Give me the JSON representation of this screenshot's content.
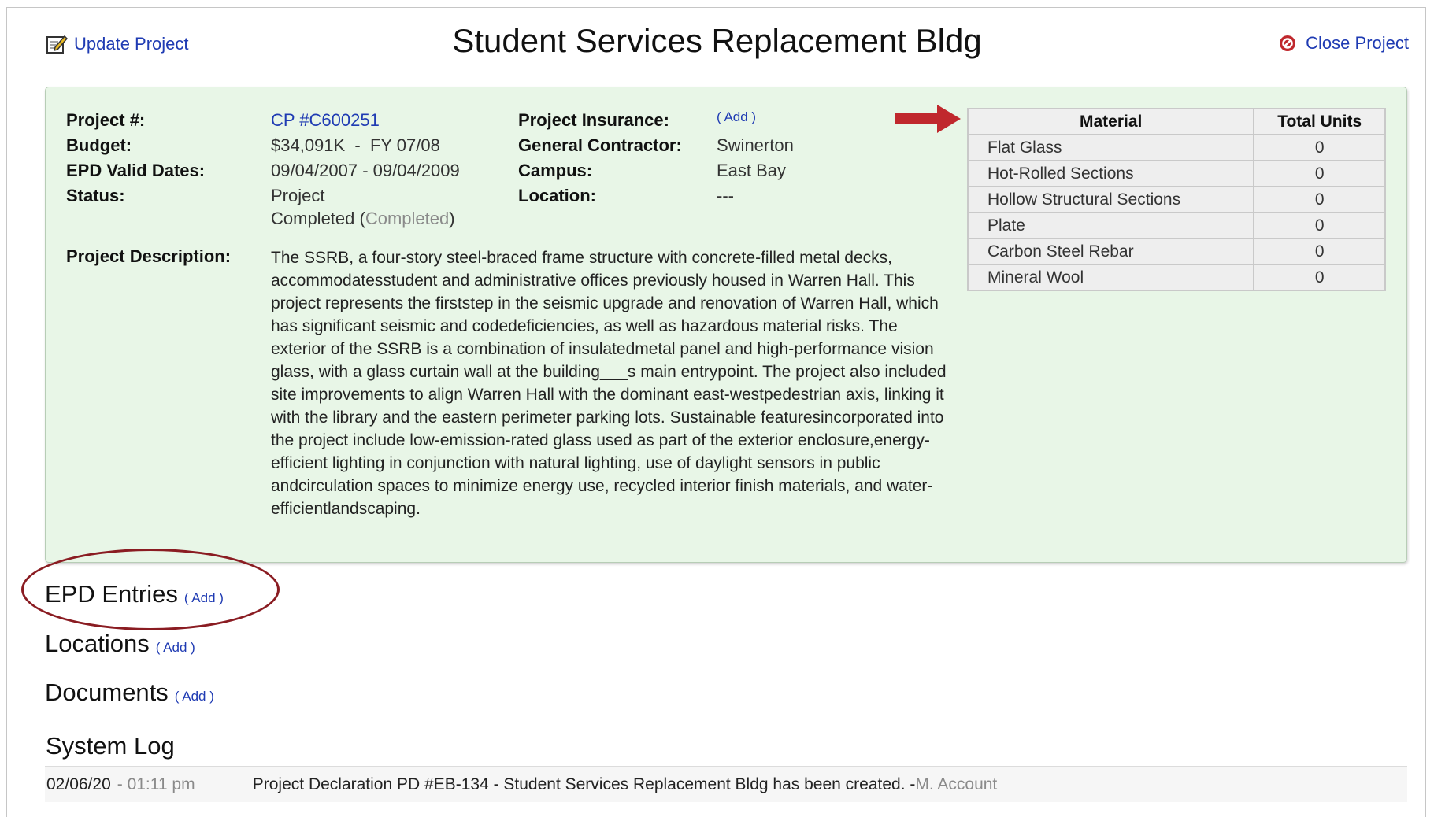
{
  "header": {
    "update_label": "Update Project",
    "title": "Student Services Replacement Bldg",
    "close_label": "Close Project"
  },
  "project": {
    "number_label": "Project #:",
    "number_value": "CP #C600251",
    "budget_label": "Budget:",
    "budget_value": "$34,091K  -  FY 07/08",
    "epd_dates_label": "EPD Valid Dates:",
    "epd_dates_value": "09/04/2007 - 09/04/2009",
    "status_label": "Status:",
    "status_line1": "Project",
    "status_line2": "Completed",
    "status_paren_open": "(",
    "status_paren_value": "Completed",
    "status_paren_close": ")",
    "insurance_label": "Project Insurance:",
    "insurance_add": "( Add )",
    "contractor_label": "General Contractor:",
    "contractor_value": "Swinerton",
    "campus_label": "Campus:",
    "campus_value": "East Bay",
    "location_label": "Location:",
    "location_value": "---",
    "description_label": "Project Description:",
    "description_value": "The SSRB, a four-story steel-braced frame structure with concrete-filled metal decks, accommodatesstudent and administrative offices previously housed in Warren Hall. This project represents the firststep in the seismic upgrade and renovation of Warren Hall, which has significant seismic and codedeficiencies, as well as hazardous material risks. The exterior of the SSRB is a combination of insulatedmetal panel and high-performance vision glass, with a glass curtain wall at the building___s main entrypoint. The project also included site improvements to align Warren Hall with the dominant east-westpedestrian axis, linking it with the library and the eastern perimeter parking lots. Sustainable featuresincorporated into the project include low-emission-rated glass used as part of the exterior enclosure,energy-efficient lighting in conjunction with natural lighting, use of daylight sensors in public andcirculation spaces to minimize energy use, recycled interior finish materials, and water-efficientlandscaping."
  },
  "materials": {
    "headers": [
      "Material",
      "Total Units"
    ],
    "rows": [
      {
        "name": "Flat Glass",
        "units": "0"
      },
      {
        "name": "Hot-Rolled Sections",
        "units": "0"
      },
      {
        "name": "Hollow Structural Sections",
        "units": "0"
      },
      {
        "name": "Plate",
        "units": "0"
      },
      {
        "name": "Carbon Steel Rebar",
        "units": "0"
      },
      {
        "name": "Mineral Wool",
        "units": "0"
      }
    ]
  },
  "sections": {
    "epd_entries": "EPD Entries",
    "locations": "Locations",
    "documents": "Documents",
    "add_label": "( Add )"
  },
  "system_log": {
    "title": "System Log",
    "entries": [
      {
        "date": "02/06/20",
        "time": "- 01:11 pm",
        "message": "Project Declaration PD #EB-134 - Student Services Replacement Bldg has been created. -",
        "user": " M. Account"
      }
    ]
  },
  "colors": {
    "panel_bg": "#e8f6e7",
    "link": "#1f3bb3",
    "annotation_red": "#c0282d",
    "oval": "#8a1c22"
  },
  "icons": {
    "update": "edit-note-icon",
    "close": "no-entry-icon",
    "annotation": "red-arrow-icon"
  }
}
